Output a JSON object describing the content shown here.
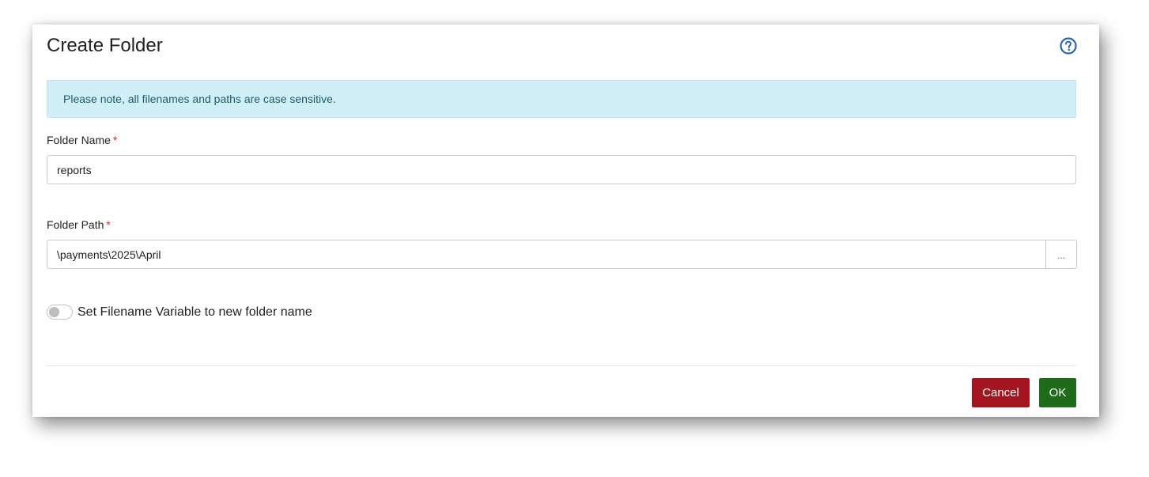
{
  "dialog": {
    "title": "Create Folder",
    "help_icon": "question-circle-icon"
  },
  "alert": {
    "text": "Please note, all filenames and paths are case sensitive."
  },
  "folder_name": {
    "label": "Folder Name",
    "required_marker": "*",
    "value": "reports"
  },
  "folder_path": {
    "label": "Folder Path",
    "required_marker": "*",
    "value": "\\payments\\2025\\April",
    "browse_label": "..."
  },
  "toggle": {
    "label": "Set Filename Variable to new folder name",
    "checked": false
  },
  "footer": {
    "cancel_label": "Cancel",
    "ok_label": "OK"
  },
  "colors": {
    "help_icon": "#2a66b6",
    "alert_bg": "#d1eff6",
    "alert_text": "#1c5b6b",
    "required": "#d9232a",
    "cancel_bg": "#a4161f",
    "ok_bg": "#1e6b1a"
  }
}
